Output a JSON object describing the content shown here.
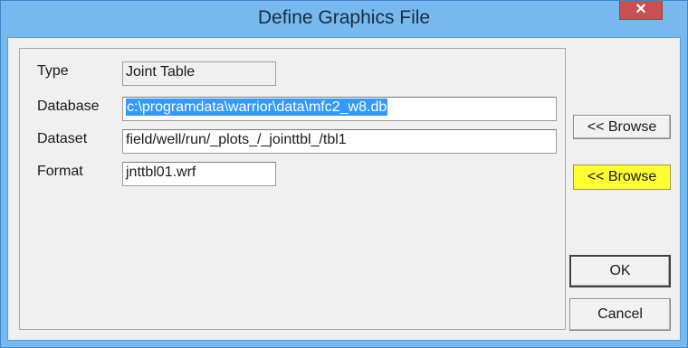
{
  "window": {
    "title": "Define Graphics File",
    "close_glyph": "✕"
  },
  "form": {
    "type": {
      "label": "Type",
      "value": "Joint Table"
    },
    "database": {
      "label": "Database",
      "value": "c:\\programdata\\warrior\\data\\mfc2_w8.db"
    },
    "dataset": {
      "label": "Dataset",
      "value": "field/well/run/_plots_/_jointtbl_/tbl1"
    },
    "format": {
      "label": "Format",
      "value": "jnttbl01.wrf"
    }
  },
  "buttons": {
    "browse_database": "<< Browse",
    "browse_format": "<< Browse",
    "ok": "OK",
    "cancel": "Cancel"
  },
  "colors": {
    "title_bar": "#76b9ee",
    "close_button": "#c75050",
    "selection": "#3399ff",
    "highlight": "#ffff33"
  }
}
